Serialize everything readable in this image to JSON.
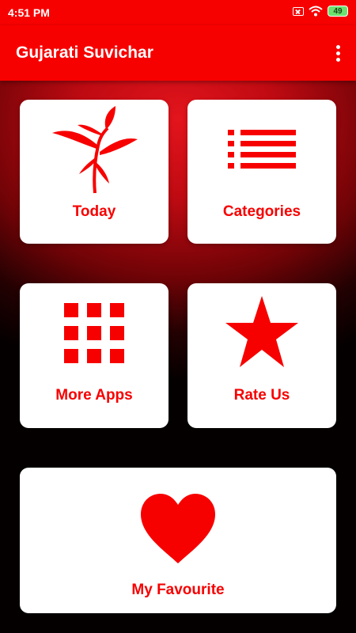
{
  "status_bar": {
    "time": "4:51 PM",
    "battery": "49"
  },
  "app_bar": {
    "title": "Gujarati Suvichar",
    "menu_icon": "more-vert-icon"
  },
  "cards": {
    "today": {
      "label": "Today",
      "icon": "plant-icon"
    },
    "categories": {
      "label": "Categories",
      "icon": "list-icon"
    },
    "more_apps": {
      "label": "More Apps",
      "icon": "grid-icon"
    },
    "rate_us": {
      "label": "Rate Us",
      "icon": "star-icon"
    },
    "favourite": {
      "label": "My Favourite",
      "icon": "heart-icon"
    }
  },
  "colors": {
    "accent": "#f70000",
    "card": "#ffffff"
  }
}
